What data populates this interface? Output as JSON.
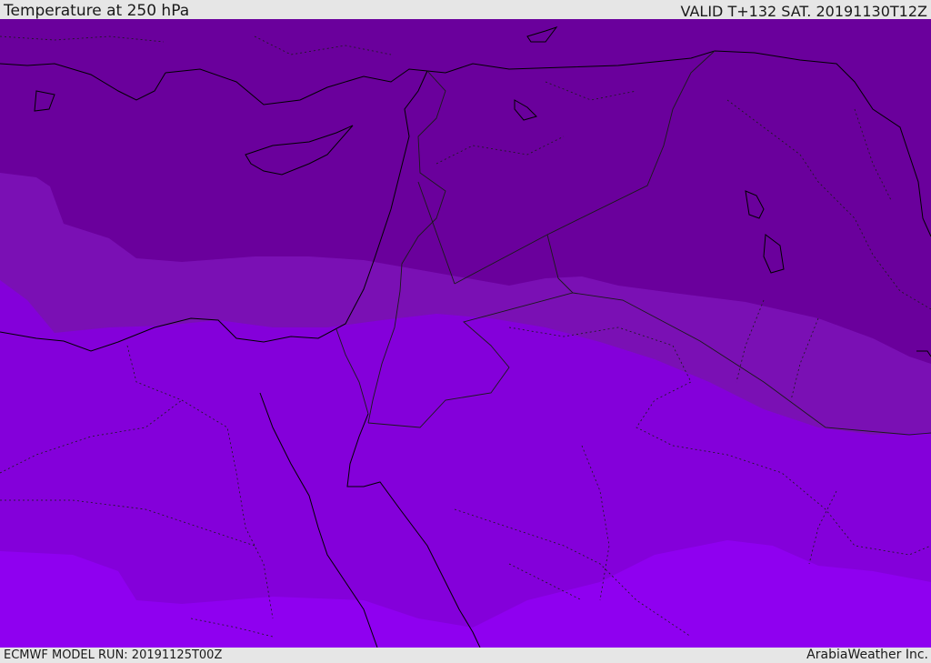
{
  "header": {
    "title": "Temperature at 250 hPa",
    "valid": "VALID T+132 SAT. 20191130T12Z"
  },
  "footer": {
    "model_run": "ECMWF MODEL RUN: 20191125T00Z",
    "credit": "ArabiaWeather Inc."
  },
  "map": {
    "colors": {
      "band_coldest": "#6a009c",
      "band_cold": "#7a10b4",
      "band_mid": "#8400da",
      "band_warm": "#8f00f0",
      "coastline": "#000000",
      "border": "#1a1a1a"
    }
  }
}
